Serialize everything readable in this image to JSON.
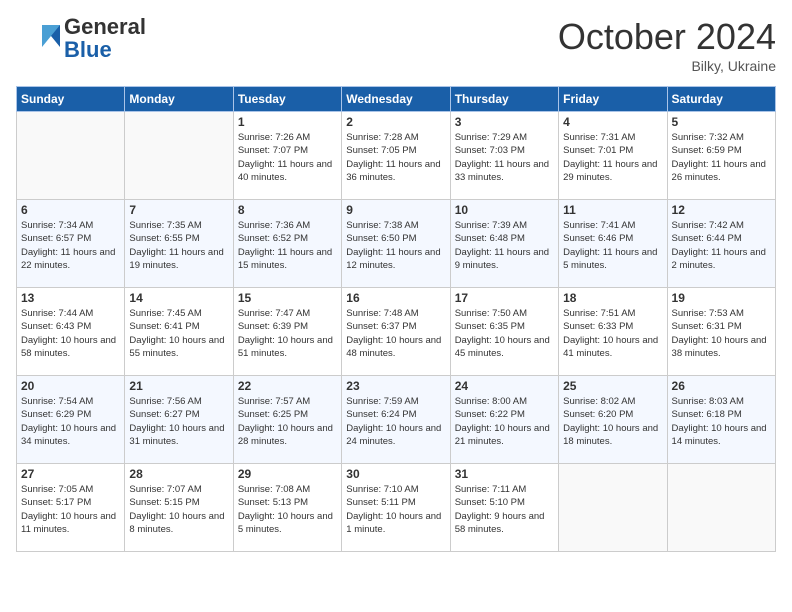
{
  "header": {
    "logo_general": "General",
    "logo_blue": "Blue",
    "month_title": "October 2024",
    "location": "Bilky, Ukraine"
  },
  "days_of_week": [
    "Sunday",
    "Monday",
    "Tuesday",
    "Wednesday",
    "Thursday",
    "Friday",
    "Saturday"
  ],
  "weeks": [
    [
      {
        "day": "",
        "info": ""
      },
      {
        "day": "",
        "info": ""
      },
      {
        "day": "1",
        "info": "Sunrise: 7:26 AM\nSunset: 7:07 PM\nDaylight: 11 hours and 40 minutes."
      },
      {
        "day": "2",
        "info": "Sunrise: 7:28 AM\nSunset: 7:05 PM\nDaylight: 11 hours and 36 minutes."
      },
      {
        "day": "3",
        "info": "Sunrise: 7:29 AM\nSunset: 7:03 PM\nDaylight: 11 hours and 33 minutes."
      },
      {
        "day": "4",
        "info": "Sunrise: 7:31 AM\nSunset: 7:01 PM\nDaylight: 11 hours and 29 minutes."
      },
      {
        "day": "5",
        "info": "Sunrise: 7:32 AM\nSunset: 6:59 PM\nDaylight: 11 hours and 26 minutes."
      }
    ],
    [
      {
        "day": "6",
        "info": "Sunrise: 7:34 AM\nSunset: 6:57 PM\nDaylight: 11 hours and 22 minutes."
      },
      {
        "day": "7",
        "info": "Sunrise: 7:35 AM\nSunset: 6:55 PM\nDaylight: 11 hours and 19 minutes."
      },
      {
        "day": "8",
        "info": "Sunrise: 7:36 AM\nSunset: 6:52 PM\nDaylight: 11 hours and 15 minutes."
      },
      {
        "day": "9",
        "info": "Sunrise: 7:38 AM\nSunset: 6:50 PM\nDaylight: 11 hours and 12 minutes."
      },
      {
        "day": "10",
        "info": "Sunrise: 7:39 AM\nSunset: 6:48 PM\nDaylight: 11 hours and 9 minutes."
      },
      {
        "day": "11",
        "info": "Sunrise: 7:41 AM\nSunset: 6:46 PM\nDaylight: 11 hours and 5 minutes."
      },
      {
        "day": "12",
        "info": "Sunrise: 7:42 AM\nSunset: 6:44 PM\nDaylight: 11 hours and 2 minutes."
      }
    ],
    [
      {
        "day": "13",
        "info": "Sunrise: 7:44 AM\nSunset: 6:43 PM\nDaylight: 10 hours and 58 minutes."
      },
      {
        "day": "14",
        "info": "Sunrise: 7:45 AM\nSunset: 6:41 PM\nDaylight: 10 hours and 55 minutes."
      },
      {
        "day": "15",
        "info": "Sunrise: 7:47 AM\nSunset: 6:39 PM\nDaylight: 10 hours and 51 minutes."
      },
      {
        "day": "16",
        "info": "Sunrise: 7:48 AM\nSunset: 6:37 PM\nDaylight: 10 hours and 48 minutes."
      },
      {
        "day": "17",
        "info": "Sunrise: 7:50 AM\nSunset: 6:35 PM\nDaylight: 10 hours and 45 minutes."
      },
      {
        "day": "18",
        "info": "Sunrise: 7:51 AM\nSunset: 6:33 PM\nDaylight: 10 hours and 41 minutes."
      },
      {
        "day": "19",
        "info": "Sunrise: 7:53 AM\nSunset: 6:31 PM\nDaylight: 10 hours and 38 minutes."
      }
    ],
    [
      {
        "day": "20",
        "info": "Sunrise: 7:54 AM\nSunset: 6:29 PM\nDaylight: 10 hours and 34 minutes."
      },
      {
        "day": "21",
        "info": "Sunrise: 7:56 AM\nSunset: 6:27 PM\nDaylight: 10 hours and 31 minutes."
      },
      {
        "day": "22",
        "info": "Sunrise: 7:57 AM\nSunset: 6:25 PM\nDaylight: 10 hours and 28 minutes."
      },
      {
        "day": "23",
        "info": "Sunrise: 7:59 AM\nSunset: 6:24 PM\nDaylight: 10 hours and 24 minutes."
      },
      {
        "day": "24",
        "info": "Sunrise: 8:00 AM\nSunset: 6:22 PM\nDaylight: 10 hours and 21 minutes."
      },
      {
        "day": "25",
        "info": "Sunrise: 8:02 AM\nSunset: 6:20 PM\nDaylight: 10 hours and 18 minutes."
      },
      {
        "day": "26",
        "info": "Sunrise: 8:03 AM\nSunset: 6:18 PM\nDaylight: 10 hours and 14 minutes."
      }
    ],
    [
      {
        "day": "27",
        "info": "Sunrise: 7:05 AM\nSunset: 5:17 PM\nDaylight: 10 hours and 11 minutes."
      },
      {
        "day": "28",
        "info": "Sunrise: 7:07 AM\nSunset: 5:15 PM\nDaylight: 10 hours and 8 minutes."
      },
      {
        "day": "29",
        "info": "Sunrise: 7:08 AM\nSunset: 5:13 PM\nDaylight: 10 hours and 5 minutes."
      },
      {
        "day": "30",
        "info": "Sunrise: 7:10 AM\nSunset: 5:11 PM\nDaylight: 10 hours and 1 minute."
      },
      {
        "day": "31",
        "info": "Sunrise: 7:11 AM\nSunset: 5:10 PM\nDaylight: 9 hours and 58 minutes."
      },
      {
        "day": "",
        "info": ""
      },
      {
        "day": "",
        "info": ""
      }
    ]
  ]
}
